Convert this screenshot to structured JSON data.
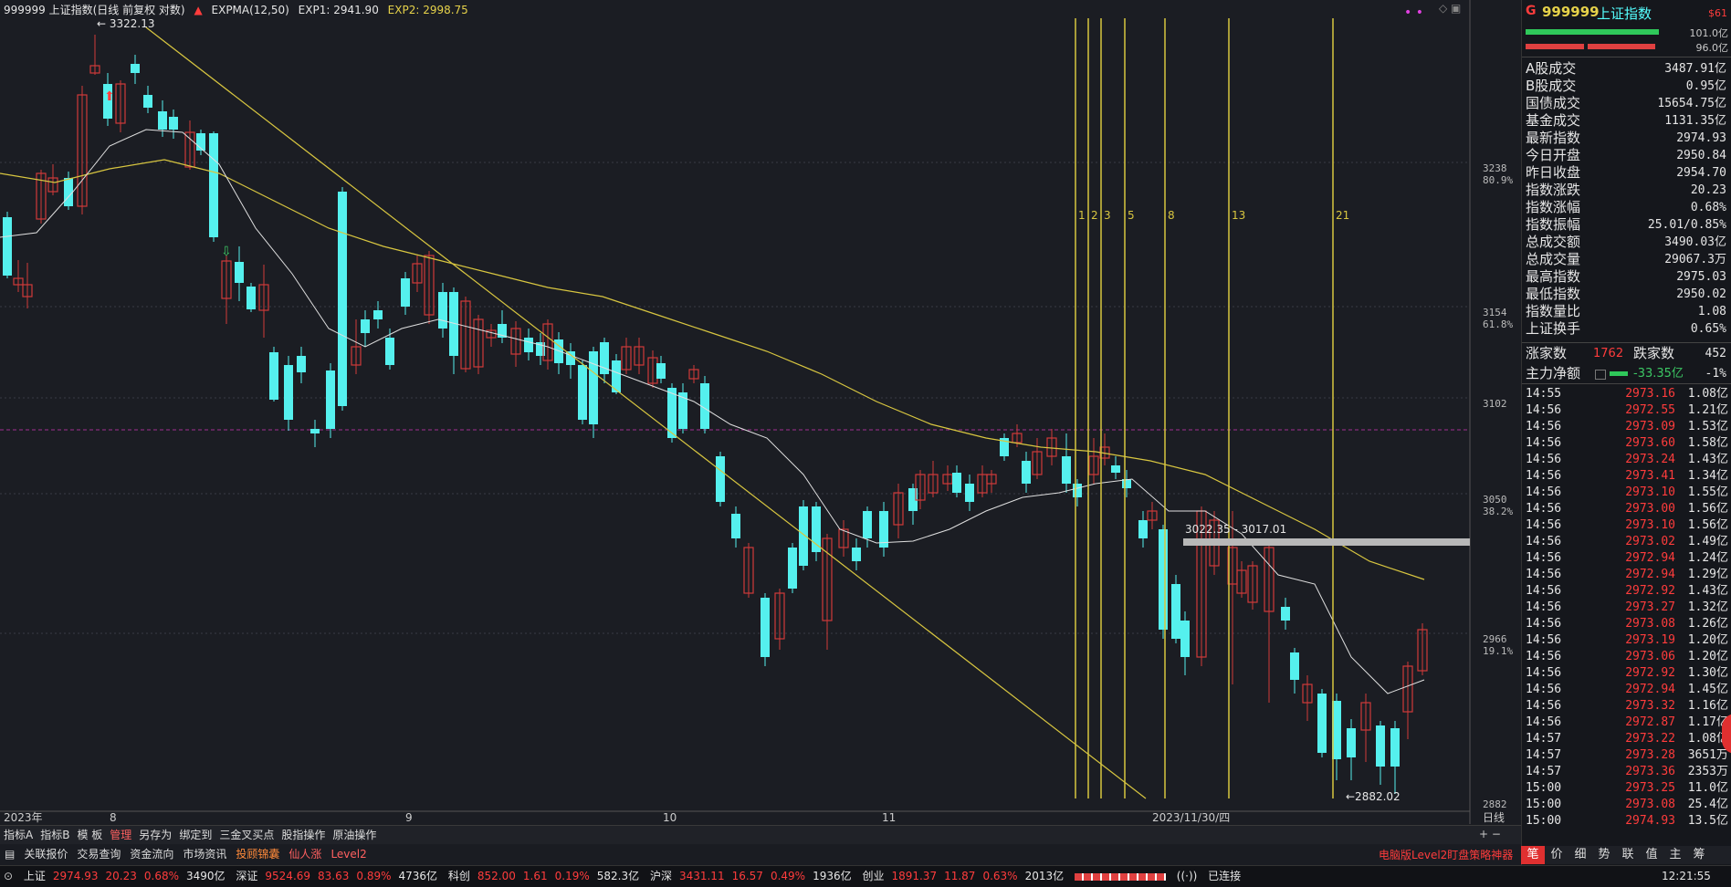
{
  "legend": {
    "title": "999999 上证指数(日线 前复权 对数)",
    "indicator": "EXPMA(12,50)",
    "exp1": "EXP1: 2941.90",
    "exp2": "EXP2: 2998.75"
  },
  "chart_annotations": {
    "high_label": "3322.13",
    "low_label": "←2882.02",
    "range_label": "3022.35 - 3017.01",
    "fib_labels": [
      "1",
      "2",
      "3",
      "5",
      "8",
      "13",
      "21"
    ]
  },
  "y_axis": [
    {
      "price": "3238",
      "pct": "80.9%"
    },
    {
      "price": "3154",
      "pct": "61.8%"
    },
    {
      "price": "3102",
      "pct": ""
    },
    {
      "price": "3050",
      "pct": "38.2%"
    },
    {
      "price": "2966",
      "pct": "19.1%"
    },
    {
      "price": "2882",
      "pct": ""
    }
  ],
  "x_axis": [
    "2023年",
    "8",
    "9",
    "10",
    "11",
    "2023/11/30/四"
  ],
  "x_axis_right": "日线",
  "bottom_tabs": [
    "指标A",
    "指标B",
    "模 板",
    "管理",
    "另存为",
    "绑定到",
    "三金叉买点",
    "股指操作",
    "原油操作"
  ],
  "bottom_tab_active": "管理",
  "news_bar": [
    "关联报价",
    "交易查询",
    "资金流向",
    "市场资讯",
    "投顾锦囊",
    "仙人涨",
    "Level2"
  ],
  "news_right": "电脑版Level2盯盘策略神器>",
  "right_panel": {
    "code": "999999",
    "name": "上证指数",
    "badge": "$61",
    "bar1_val": "101.0亿",
    "bar2_val": "96.0亿",
    "stats": [
      {
        "k": "A股成交",
        "v": "3487.91亿",
        "c": "wh"
      },
      {
        "k": "B股成交",
        "v": "0.95亿",
        "c": "wh"
      },
      {
        "k": "国债成交",
        "v": "15654.75亿",
        "c": "wh"
      },
      {
        "k": "基金成交",
        "v": "1131.35亿",
        "c": "wh"
      },
      {
        "k": "最新指数",
        "v": "2974.93",
        "c": "up"
      },
      {
        "k": "今日开盘",
        "v": "2950.84",
        "c": "down"
      },
      {
        "k": "昨日收盘",
        "v": "2954.70",
        "c": "wh"
      },
      {
        "k": "指数涨跌",
        "v": "20.23",
        "c": "up"
      },
      {
        "k": "指数涨幅",
        "v": "0.68%",
        "c": "up"
      },
      {
        "k": "指数振幅",
        "v": "25.01/0.85%",
        "c": "wh"
      },
      {
        "k": "总成交额",
        "v": "3490.03亿",
        "c": "wh"
      },
      {
        "k": "总成交量",
        "v": "29067.3万",
        "c": "wh"
      },
      {
        "k": "最高指数",
        "v": "2975.03",
        "c": "up"
      },
      {
        "k": "最低指数",
        "v": "2950.02",
        "c": "down"
      },
      {
        "k": "指数量比",
        "v": "1.08",
        "c": "up"
      },
      {
        "k": "上证换手",
        "v": "0.65%",
        "c": "wh"
      }
    ],
    "rise_label": "涨家数",
    "rise_val": "1762",
    "fall_label": "跌家数",
    "fall_val": "452",
    "net_label": "主力净额",
    "net_val": "-33.35亿",
    "net_pct": "-1%",
    "ticks": [
      [
        "14:55",
        "2973.16",
        "1.08亿"
      ],
      [
        "14:56",
        "2972.55",
        "1.21亿"
      ],
      [
        "14:56",
        "2973.09",
        "1.53亿"
      ],
      [
        "14:56",
        "2973.60",
        "1.58亿"
      ],
      [
        "14:56",
        "2973.24",
        "1.43亿"
      ],
      [
        "14:56",
        "2973.41",
        "1.34亿"
      ],
      [
        "14:56",
        "2973.10",
        "1.55亿"
      ],
      [
        "14:56",
        "2973.00",
        "1.56亿"
      ],
      [
        "14:56",
        "2973.10",
        "1.56亿"
      ],
      [
        "14:56",
        "2973.02",
        "1.49亿"
      ],
      [
        "14:56",
        "2972.94",
        "1.24亿"
      ],
      [
        "14:56",
        "2972.94",
        "1.29亿"
      ],
      [
        "14:56",
        "2972.92",
        "1.43亿"
      ],
      [
        "14:56",
        "2973.27",
        "1.32亿"
      ],
      [
        "14:56",
        "2973.08",
        "1.26亿"
      ],
      [
        "14:56",
        "2973.19",
        "1.20亿"
      ],
      [
        "14:56",
        "2973.06",
        "1.20亿"
      ],
      [
        "14:56",
        "2972.92",
        "1.30亿"
      ],
      [
        "14:56",
        "2972.94",
        "1.45亿"
      ],
      [
        "14:56",
        "2973.32",
        "1.16亿"
      ],
      [
        "14:56",
        "2972.87",
        "1.17亿"
      ],
      [
        "14:57",
        "2973.22",
        "1.08亿"
      ],
      [
        "14:57",
        "2973.28",
        "3651万"
      ],
      [
        "14:57",
        "2973.36",
        "2353万"
      ],
      [
        "15:00",
        "2973.25",
        "11.0亿"
      ],
      [
        "15:00",
        "2973.08",
        "25.4亿"
      ],
      [
        "15:00",
        "2974.93",
        "13.5亿"
      ]
    ],
    "tabs": [
      "笔",
      "价",
      "细",
      "势",
      "联",
      "值",
      "主",
      "筹"
    ]
  },
  "status_bar": {
    "sh_label": "上证",
    "sh_price": "2974.93",
    "sh_chg": "20.23",
    "sh_pct": "0.68%",
    "sh_amt": "3490亿",
    "sz_label": "深证",
    "sz_price": "9524.69",
    "sz_chg": "83.63",
    "sz_pct": "0.89%",
    "sz_amt": "4736亿",
    "kc_label": "科创",
    "kc_price": "852.00",
    "kc_chg": "1.61",
    "kc_pct": "0.19%",
    "kc_amt": "582.3亿",
    "hs_label": "沪深",
    "hs_price": "3431.11",
    "hs_chg": "16.57",
    "hs_pct": "0.49%",
    "hs_amt": "1936亿",
    "cy_label": "创业",
    "cy_price": "1891.37",
    "cy_chg": "11.87",
    "cy_pct": "0.63%",
    "cy_amt": "2013亿",
    "conn": "已连接",
    "time": "12:21:55"
  }
}
